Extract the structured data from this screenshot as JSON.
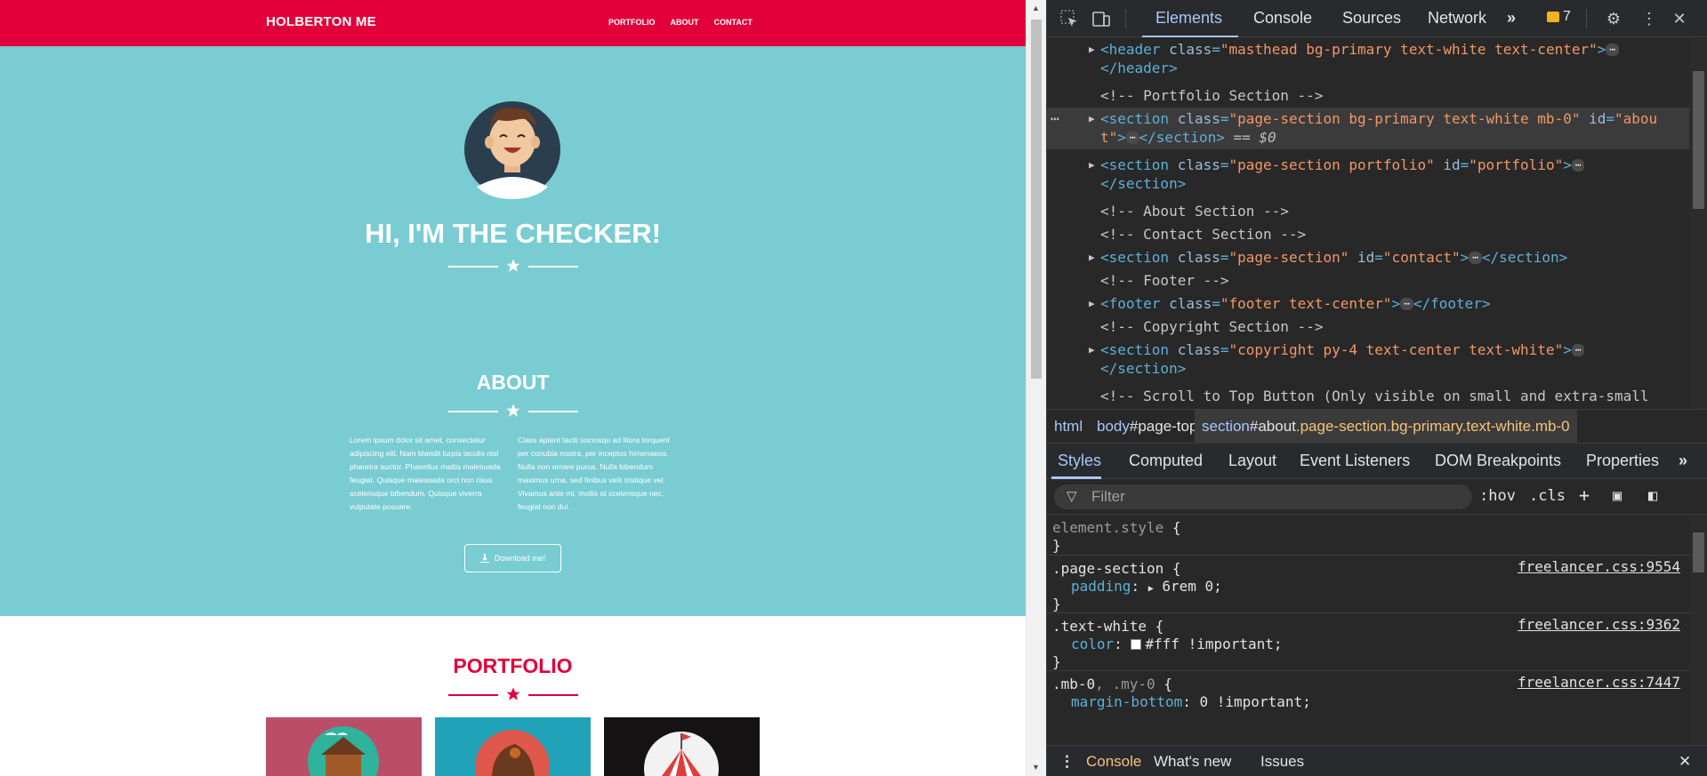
{
  "page": {
    "brand": "HOLBERTON ME",
    "nav": [
      "PORTFOLIO",
      "ABOUT",
      "CONTACT"
    ],
    "hero_title": "HI, I'M THE CHECKER!",
    "about_title": "ABOUT",
    "about_left": "Lorem ipsum dolor sit amet, consectetur adipiscing elit. Nam blandit turpis iaculis nisl pharetra auctor. Phasellus mattis malesuada feugiat. Quisque malesuada orci non risus scelerisque bibendum. Quisque viverra vulputate posuere.",
    "about_right": "Class aptent taciti sociosqu ad litora torquent per conubia nostra, per inceptos himenaeos. Nulla non ornare purus. Nulla bibendum maximus urna, sed finibus velit tristique vel. Vivamus ante mi, mollis at scelerisque nec, feugiat non dui.",
    "download_label": "Download me!",
    "portfolio_title": "PORTFOLIO",
    "colors": {
      "navbar": "#e1003a",
      "hero": "#79ccd2",
      "accent": "#e1003a"
    }
  },
  "devtools": {
    "tabs": [
      "Elements",
      "Console",
      "Sources",
      "Network"
    ],
    "more_tabs": "»",
    "issues_count": "7",
    "dom": [
      {
        "pre": "<",
        "tag": "header",
        "attrs": [
          [
            "class",
            "\"masthead bg-primary text-white text-center\""
          ]
        ],
        "close": ">",
        "dots": true,
        "line2": "</header>",
        "line2_tag": true
      },
      {
        "comment": "<!-- Portfolio Section -->"
      },
      {
        "selected": true,
        "pre": "<",
        "tag": "section",
        "attrs": [
          [
            "class",
            "\"page-section bg-primary text-white mb-0\""
          ],
          [
            "id",
            "\"abou"
          ]
        ],
        "close": "",
        "wrap": "t\">",
        "dots": true,
        "wrap_end": "</section>",
        "eq": "== $0"
      },
      {
        "pre": "<",
        "tag": "section",
        "attrs": [
          [
            "class",
            "\"page-section portfolio\""
          ],
          [
            "id",
            "\"portfolio\""
          ]
        ],
        "close": ">",
        "dots": true,
        "line2": "</section>",
        "line2_tag": true
      },
      {
        "comment": "<!-- About Section -->"
      },
      {
        "comment": "<!-- Contact Section -->"
      },
      {
        "pre": "<",
        "tag": "section",
        "attrs": [
          [
            "class",
            "\"page-section\""
          ],
          [
            "id",
            "\"contact\""
          ]
        ],
        "close": ">",
        "dots": true,
        "tail": "</section>"
      },
      {
        "comment": "<!-- Footer -->"
      },
      {
        "pre": "<",
        "tag": "footer",
        "attrs": [
          [
            "class",
            "\"footer text-center\""
          ]
        ],
        "close": ">",
        "dots": true,
        "tail": "</footer>"
      },
      {
        "comment": "<!-- Copyright Section -->"
      },
      {
        "pre": "<",
        "tag": "section",
        "attrs": [
          [
            "class",
            "\"copyright py-4 text-center text-white\""
          ]
        ],
        "close": ">",
        "dots": true,
        "line2": "</section>",
        "line2_tag": true
      },
      {
        "comment": "<!-- Scroll to Top Button (Only visible on small and extra-small"
      }
    ],
    "breadcrumb": {
      "c1": "html",
      "c2_tag": "body",
      "c2_id": "#page-top",
      "c3_tag": "section",
      "c3_id": "#about",
      "c3_cls": ".page-section.bg-primary.text-white.mb-0"
    },
    "style_tabs": [
      "Styles",
      "Computed",
      "Layout",
      "Event Listeners",
      "DOM Breakpoints",
      "Properties"
    ],
    "filter_placeholder": "Filter",
    "filter_buttons": [
      ":hov",
      ".cls"
    ],
    "rules": [
      {
        "selector": "element.style",
        "open": "{",
        "close": "}"
      },
      {
        "selector": ".page-section",
        "source": "freelancer.css:9554",
        "prop": "padding",
        "value": "6rem 0;"
      },
      {
        "selector": ".text-white",
        "source": "freelancer.css:9362",
        "prop": "color",
        "value": "#fff !important;"
      },
      {
        "selector": ".mb-0",
        "selector_dim": ", .my-0",
        "source": "freelancer.css:7447",
        "prop": "margin-bottom",
        "value": "0 !important;"
      }
    ],
    "drawer_tabs": [
      "Console",
      "What's new",
      "Issues"
    ]
  }
}
